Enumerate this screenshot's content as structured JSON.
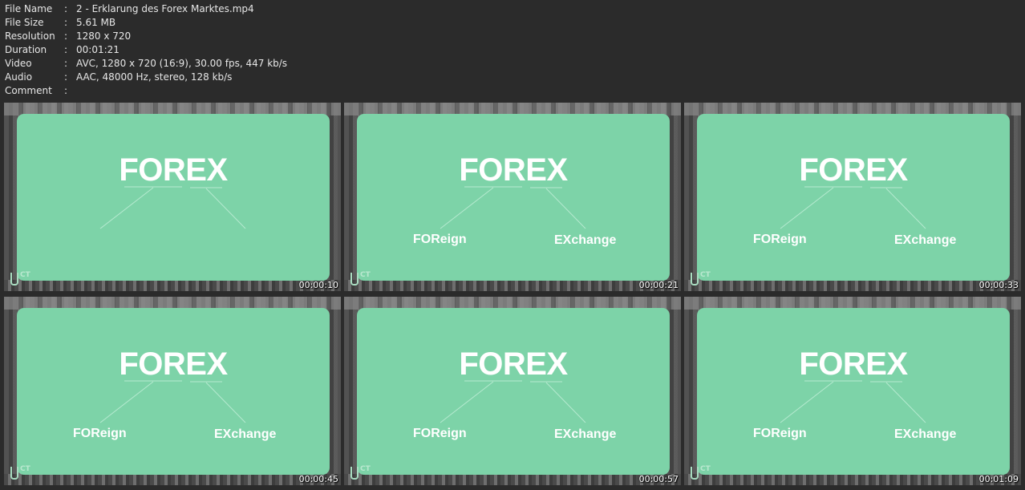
{
  "info": [
    {
      "key": "File Name",
      "value": "2 - Erklarung des Forex Marktes.mp4"
    },
    {
      "key": "File Size",
      "value": "5.61 MB"
    },
    {
      "key": "Resolution",
      "value": "1280 x 720"
    },
    {
      "key": "Duration",
      "value": "00:01:21"
    },
    {
      "key": "Video",
      "value": "AVC, 1280 x 720 (16:9), 30.00 fps, 447 kb/s"
    },
    {
      "key": "Audio",
      "value": "AAC, 48000 Hz, stereo, 128 kb/s"
    },
    {
      "key": "Comment",
      "value": ""
    }
  ],
  "separator": ":",
  "thumbnails": [
    {
      "title": "FOREX",
      "left_word": "",
      "right_word": "",
      "timestamp": "00:00:10"
    },
    {
      "title": "FOREX",
      "left_word": "FOReign",
      "right_word": "EXchange",
      "timestamp": "00:00:21"
    },
    {
      "title": "FOREX",
      "left_word": "FOReign",
      "right_word": "EXchange",
      "timestamp": "00:00:33"
    },
    {
      "title": "FOREX",
      "left_word": "FOReign",
      "right_word": "EXchange",
      "timestamp": "00:00:45"
    },
    {
      "title": "FOREX",
      "left_word": "FOReign",
      "right_word": "EXchange",
      "timestamp": "00:00:57"
    },
    {
      "title": "FOREX",
      "left_word": "FOReign",
      "right_word": "EXchange",
      "timestamp": "00:01:09"
    }
  ],
  "logo_text": "CT",
  "colors": {
    "card": "#7dd3a8",
    "background": "#2b2b2b"
  }
}
